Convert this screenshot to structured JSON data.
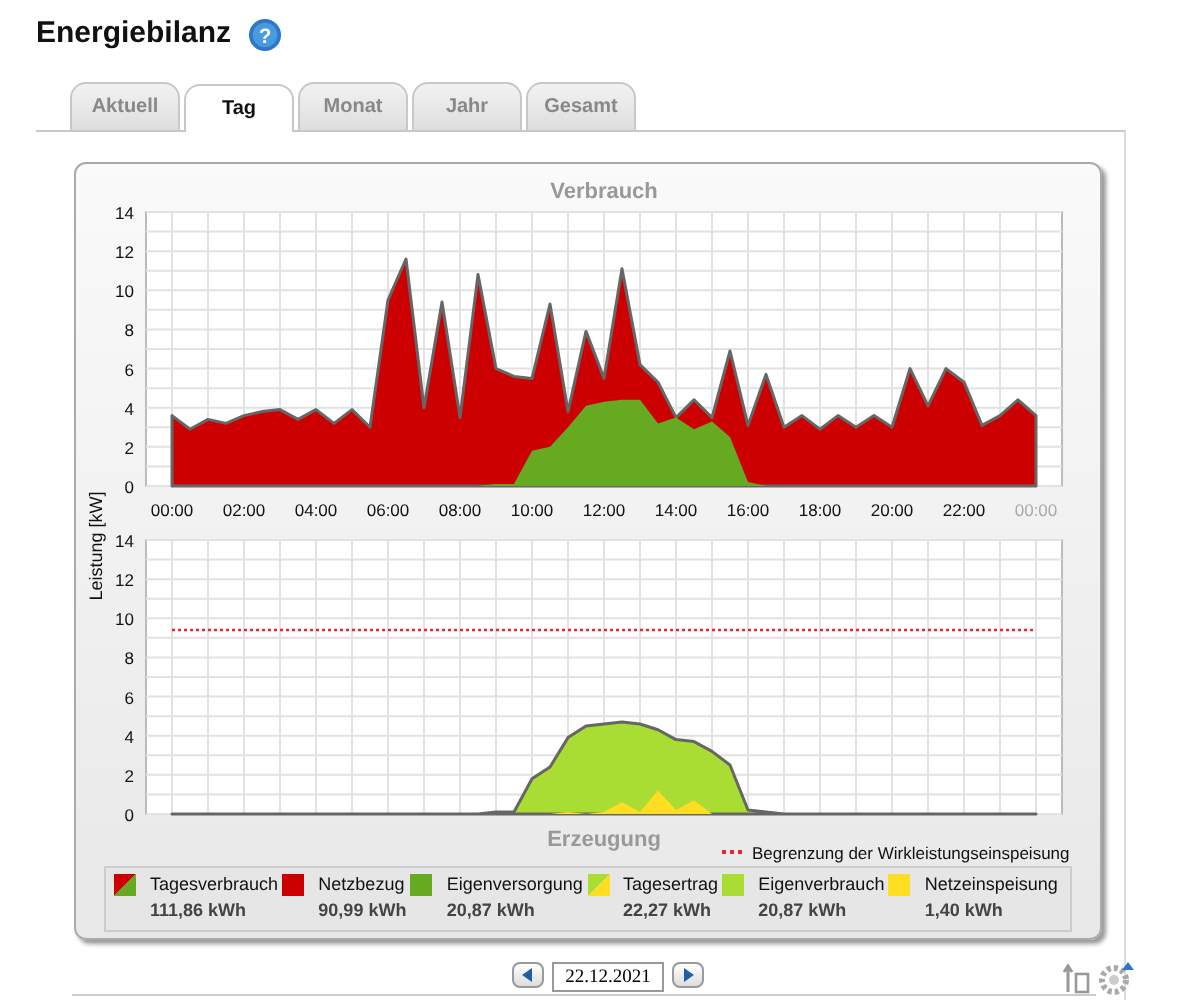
{
  "header": {
    "title": "Energiebilanz",
    "help_icon": "?"
  },
  "tabs": [
    {
      "label": "Aktuell",
      "selected": false
    },
    {
      "label": "Tag",
      "selected": true
    },
    {
      "label": "Monat",
      "selected": false
    },
    {
      "label": "Jahr",
      "selected": false
    },
    {
      "label": "Gesamt",
      "selected": false
    }
  ],
  "charts": [
    {
      "chart_data": {
        "type": "area",
        "grid": true,
        "title": "Verbrauch",
        "ylabel": "Leistung [kW]",
        "x": [
          0,
          0.5,
          1,
          1.5,
          2,
          2.5,
          3,
          3.5,
          4,
          4.5,
          5,
          5.5,
          6,
          6.5,
          7,
          7.5,
          8,
          8.5,
          9,
          9.5,
          10,
          10.5,
          11,
          11.5,
          12,
          12.5,
          13,
          13.5,
          14,
          14.5,
          15,
          15.5,
          16,
          16.5,
          17,
          17.5,
          18,
          18.5,
          19,
          19.5,
          20,
          20.5,
          21,
          21.5,
          22,
          22.5,
          23,
          23.5,
          24
        ],
        "xlim": [
          0,
          24
        ],
        "ylim": [
          0,
          14
        ],
        "xticks": [
          {
            "value": 0,
            "label": "00:00"
          },
          {
            "value": 2,
            "label": "02:00"
          },
          {
            "value": 4,
            "label": "04:00"
          },
          {
            "value": 6,
            "label": "06:00"
          },
          {
            "value": 8,
            "label": "08:00"
          },
          {
            "value": 10,
            "label": "10:00"
          },
          {
            "value": 12,
            "label": "12:00"
          },
          {
            "value": 14,
            "label": "14:00"
          },
          {
            "value": 16,
            "label": "16:00"
          },
          {
            "value": 18,
            "label": "18:00"
          },
          {
            "value": 20,
            "label": "20:00"
          },
          {
            "value": 22,
            "label": "22:00"
          },
          {
            "value": 24,
            "label": "00:00"
          }
        ],
        "yticks": [
          0,
          2,
          4,
          6,
          8,
          10,
          12,
          14
        ],
        "series": [
          {
            "color": "#cc0000",
            "values": [
              3.6,
              2.9,
              3.4,
              3.2,
              3.6,
              3.8,
              3.9,
              3.4,
              3.9,
              3.2,
              3.9,
              3.0,
              9.5,
              11.6,
              4.0,
              9.4,
              3.5,
              10.8,
              6.0,
              5.6,
              5.5,
              9.3,
              3.8,
              7.9,
              5.5,
              11.1,
              6.2,
              5.3,
              3.5,
              4.4,
              3.5,
              6.9,
              3.1,
              5.7,
              3.0,
              3.6,
              2.9,
              3.6,
              3.0,
              3.6,
              3.0,
              6.0,
              4.1,
              6.0,
              5.3,
              3.1,
              3.6,
              4.4,
              3.6
            ]
          },
          {
            "color": "#66aa22",
            "values": [
              0,
              0,
              0,
              0,
              0,
              0,
              0,
              0,
              0,
              0,
              0,
              0,
              0,
              0,
              0,
              0,
              0,
              0,
              0.1,
              0.1,
              1.8,
              2.0,
              3.0,
              4.1,
              4.3,
              4.4,
              4.4,
              3.2,
              3.5,
              2.9,
              3.3,
              2.5,
              0.2,
              0,
              0,
              0,
              0,
              0,
              0,
              0,
              0,
              0,
              0,
              0,
              0,
              0,
              0,
              0,
              0
            ]
          }
        ]
      }
    },
    {
      "chart_data": {
        "type": "area",
        "grid": true,
        "title": "Erzeugung",
        "x": [
          0,
          0.5,
          1,
          1.5,
          2,
          2.5,
          3,
          3.5,
          4,
          4.5,
          5,
          5.5,
          6,
          6.5,
          7,
          7.5,
          8,
          8.5,
          9,
          9.5,
          10,
          10.5,
          11,
          11.5,
          12,
          12.5,
          13,
          13.5,
          14,
          14.5,
          15,
          15.5,
          16,
          16.5,
          17,
          17.5,
          18,
          18.5,
          19,
          19.5,
          20,
          20.5,
          21,
          21.5,
          22,
          22.5,
          23,
          23.5,
          24
        ],
        "xlim": [
          0,
          24
        ],
        "ylim": [
          0,
          14
        ],
        "yticks": [
          0,
          2,
          4,
          6,
          8,
          10,
          12,
          14
        ],
        "series": [
          {
            "color": "#aadd33",
            "values": [
              0,
              0,
              0,
              0,
              0,
              0,
              0,
              0,
              0,
              0,
              0,
              0,
              0,
              0,
              0,
              0,
              0,
              0,
              0.1,
              0.1,
              1.8,
              2.4,
              3.9,
              4.5,
              4.6,
              4.7,
              4.6,
              4.3,
              3.8,
              3.7,
              3.2,
              2.5,
              0.2,
              0.1,
              0,
              0,
              0,
              0,
              0,
              0,
              0,
              0,
              0,
              0,
              0,
              0,
              0,
              0,
              0
            ]
          },
          {
            "color": "#ffdd22",
            "values": [
              0,
              0,
              0,
              0,
              0,
              0,
              0,
              0,
              0,
              0,
              0,
              0,
              0,
              0,
              0,
              0,
              0,
              0,
              0,
              0,
              0,
              0,
              0.1,
              0,
              0.1,
              0.6,
              0.1,
              1.2,
              0.2,
              0.7,
              0,
              0,
              0,
              0,
              0,
              0,
              0,
              0,
              0,
              0,
              0,
              0,
              0,
              0,
              0,
              0,
              0,
              0,
              0
            ]
          },
          {
            "name": "Begrenzung der Wirkleistungseinspeisung",
            "type": "line",
            "line_style": "dotted",
            "color": "#ee2233",
            "values": [
              9.4,
              9.4,
              9.4,
              9.4,
              9.4,
              9.4,
              9.4,
              9.4,
              9.4,
              9.4,
              9.4,
              9.4,
              9.4,
              9.4,
              9.4,
              9.4,
              9.4,
              9.4,
              9.4,
              9.4,
              9.4,
              9.4,
              9.4,
              9.4,
              9.4,
              9.4,
              9.4,
              9.4,
              9.4,
              9.4,
              9.4,
              9.4,
              9.4,
              9.4,
              9.4,
              9.4,
              9.4,
              9.4,
              9.4,
              9.4,
              9.4,
              9.4,
              9.4,
              9.4,
              9.4,
              9.4,
              9.4,
              9.4,
              9.4
            ]
          }
        ]
      }
    }
  ],
  "legend": [
    {
      "label": "Tagesverbrauch",
      "value": "111,86 kWh",
      "swatch": [
        {
          "color": "#cc0000"
        },
        {
          "color": "#66aa22"
        }
      ]
    },
    {
      "label": "Netzbezug",
      "value": "90,99 kWh",
      "swatch": [
        {
          "color": "#cc0000"
        }
      ]
    },
    {
      "label": "Eigenversorgung",
      "value": "20,87 kWh",
      "swatch": [
        {
          "color": "#66aa22"
        }
      ]
    },
    {
      "label": "Tagesertrag",
      "value": "22,27 kWh",
      "swatch": [
        {
          "color": "#aadd33"
        },
        {
          "color": "#ffdd22"
        }
      ]
    },
    {
      "label": "Eigenverbrauch",
      "value": "20,87 kWh",
      "swatch": [
        {
          "color": "#aadd33"
        }
      ]
    },
    {
      "label": "Netzeinspeisung",
      "value": "1,40 kWh",
      "swatch": [
        {
          "color": "#ffdd22"
        }
      ]
    }
  ],
  "date_nav": {
    "date": "22.12.2021"
  }
}
